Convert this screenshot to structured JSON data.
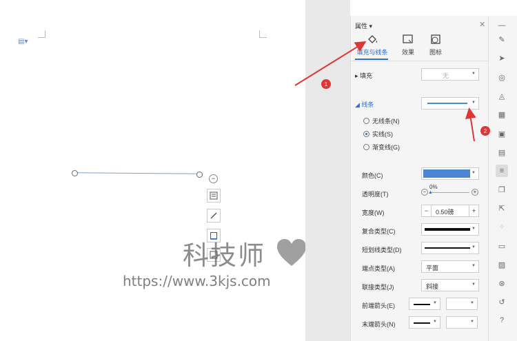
{
  "panel": {
    "title": "属性",
    "tabs": [
      {
        "label": "填充与线条",
        "active": true,
        "icon": "paint-bucket-icon"
      },
      {
        "label": "效果",
        "icon": "effects-icon"
      },
      {
        "label": "图标",
        "icon": "shape-icon"
      }
    ],
    "fill": {
      "label": "填充",
      "value": "无"
    },
    "line": {
      "label": "线条",
      "options": [
        {
          "label": "无线条(N)",
          "checked": false
        },
        {
          "label": "实线(S)",
          "checked": true
        },
        {
          "label": "渐变线(G)",
          "checked": false
        }
      ]
    },
    "props": {
      "color": {
        "label": "颜色(C)",
        "value_color": "#4a86d4"
      },
      "transparency": {
        "label": "透明度(T)",
        "value": "0%"
      },
      "width": {
        "label": "宽度(W)",
        "value": "0.50磅",
        "minus": "−",
        "plus": "+"
      },
      "compound": {
        "label": "复合类型(C)"
      },
      "dash": {
        "label": "短划线类型(D)"
      },
      "cap": {
        "label": "端点类型(A)",
        "value": "平面"
      },
      "join": {
        "label": "联接类型(J)",
        "value": "斜接"
      },
      "start_arrow": {
        "label": "前端箭头(E)"
      },
      "end_arrow": {
        "label": "末端箭头(N)"
      }
    }
  },
  "annotations": {
    "badge1": "1",
    "badge2": "2"
  },
  "watermark": {
    "title": "科技师",
    "url": "https://www.3kjs.com"
  },
  "colors": {
    "accent": "#2a6fd6",
    "arrow": "#e03535",
    "line_blue": "#4a86d4"
  },
  "rightbar_icons": [
    "collapse-icon",
    "pen-icon",
    "cursor-icon",
    "location-icon",
    "layers-icon",
    "table-icon",
    "grid-icon",
    "chart-icon",
    "properties-icon",
    "pages-icon",
    "share-icon",
    "ai-icon",
    "box-icon",
    "image-icon",
    "target-icon",
    "history-icon",
    "help-icon"
  ]
}
